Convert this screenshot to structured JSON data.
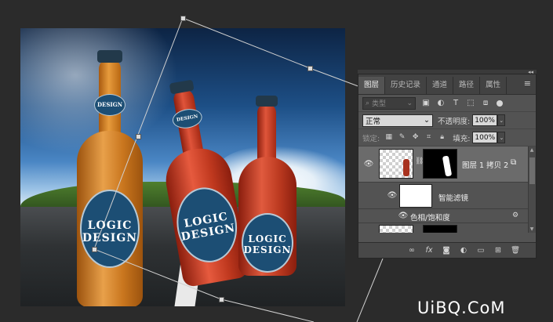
{
  "panel": {
    "tabs": [
      {
        "label": "图层",
        "active": true
      },
      {
        "label": "历史记录",
        "active": false
      },
      {
        "label": "通道",
        "active": false
      },
      {
        "label": "路径",
        "active": false
      },
      {
        "label": "属性",
        "active": false
      }
    ],
    "collapse_glyph": "◂◂",
    "menu_icon": "panel-menu-icon",
    "filter": {
      "placeholder": "类型",
      "icons": [
        "image-filter-icon",
        "adjustment-filter-icon",
        "type-filter-icon",
        "shape-filter-icon",
        "smart-object-filter-icon"
      ]
    },
    "blend_mode": "正常",
    "opacity_label": "不透明度:",
    "opacity_value": "100%",
    "lock_label": "锁定:",
    "fill_label": "填充:",
    "fill_value": "100%",
    "layers": [
      {
        "name": "图层 1 拷贝 2",
        "visible": true,
        "selected": true
      },
      {
        "name": "智能滤镜",
        "visible": true
      },
      {
        "name": "色相/饱和度",
        "visible": true
      }
    ],
    "footer_icons": [
      "link-icon",
      "fx-icon",
      "mask-icon",
      "adjustment-icon",
      "folder-icon",
      "new-layer-icon",
      "trash-icon"
    ]
  },
  "canvas": {
    "bottles": [
      {
        "label_top": "DESIGN",
        "label_line1": "LOGIC",
        "label_line2": "DESIGN"
      },
      {
        "label_top": "DESIGN",
        "label_line1": "LOGIC",
        "label_line2": "DESIGN"
      },
      {
        "label_line1": "LOGIC",
        "label_line2": "DESIGN"
      }
    ]
  },
  "watermark": "UiBQ.CoM",
  "colors": {
    "panel_bg": "#535353",
    "workspace_bg": "#2b2b2b",
    "selected_layer": "#6b6b6b"
  }
}
